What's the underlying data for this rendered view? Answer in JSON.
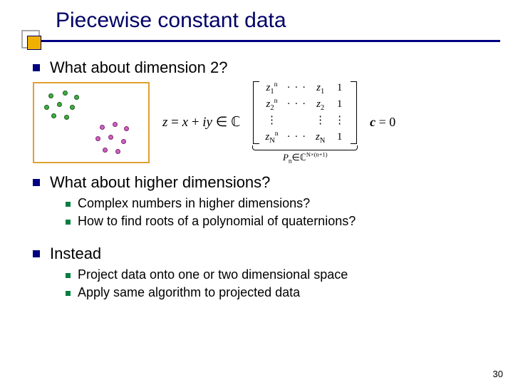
{
  "title": "Piecewise constant data",
  "page_number": "30",
  "bullets": {
    "b1": "What about dimension 2?",
    "b2": "What about higher dimensions?",
    "b2_sub1": "Complex numbers in higher dimensions?",
    "b2_sub2": "How to find roots of a polynomial of quaternions?",
    "b3": "Instead",
    "b3_sub1": "Project data onto one or two dimensional space",
    "b3_sub2": "Apply same algorithm to projected data"
  },
  "formula": {
    "text": "z = x + iy ∈ ℂ"
  },
  "matrix": {
    "r1c1": "z",
    "r1c1_sub": "1",
    "r1c1_sup": "n",
    "r2c1": "z",
    "r2c1_sub": "2",
    "r2c1_sup": "n",
    "r4c1": "z",
    "r4c1_sub": "N",
    "r4c1_sup": "n",
    "dots_h": "· · ·",
    "dots_v": "⋮",
    "r1c3": "z",
    "r1c3_sub": "1",
    "r2c3": "z",
    "r2c3_sub": "2",
    "r4c3": "z",
    "r4c3_sub": "N",
    "ones": "1",
    "underlabel_var": "P",
    "underlabel_sub": "n",
    "underlabel_rest": "∈ℂ",
    "underlabel_dim": "N×(n+1)",
    "rhs_var": "c",
    "rhs_eq": " = 0"
  }
}
